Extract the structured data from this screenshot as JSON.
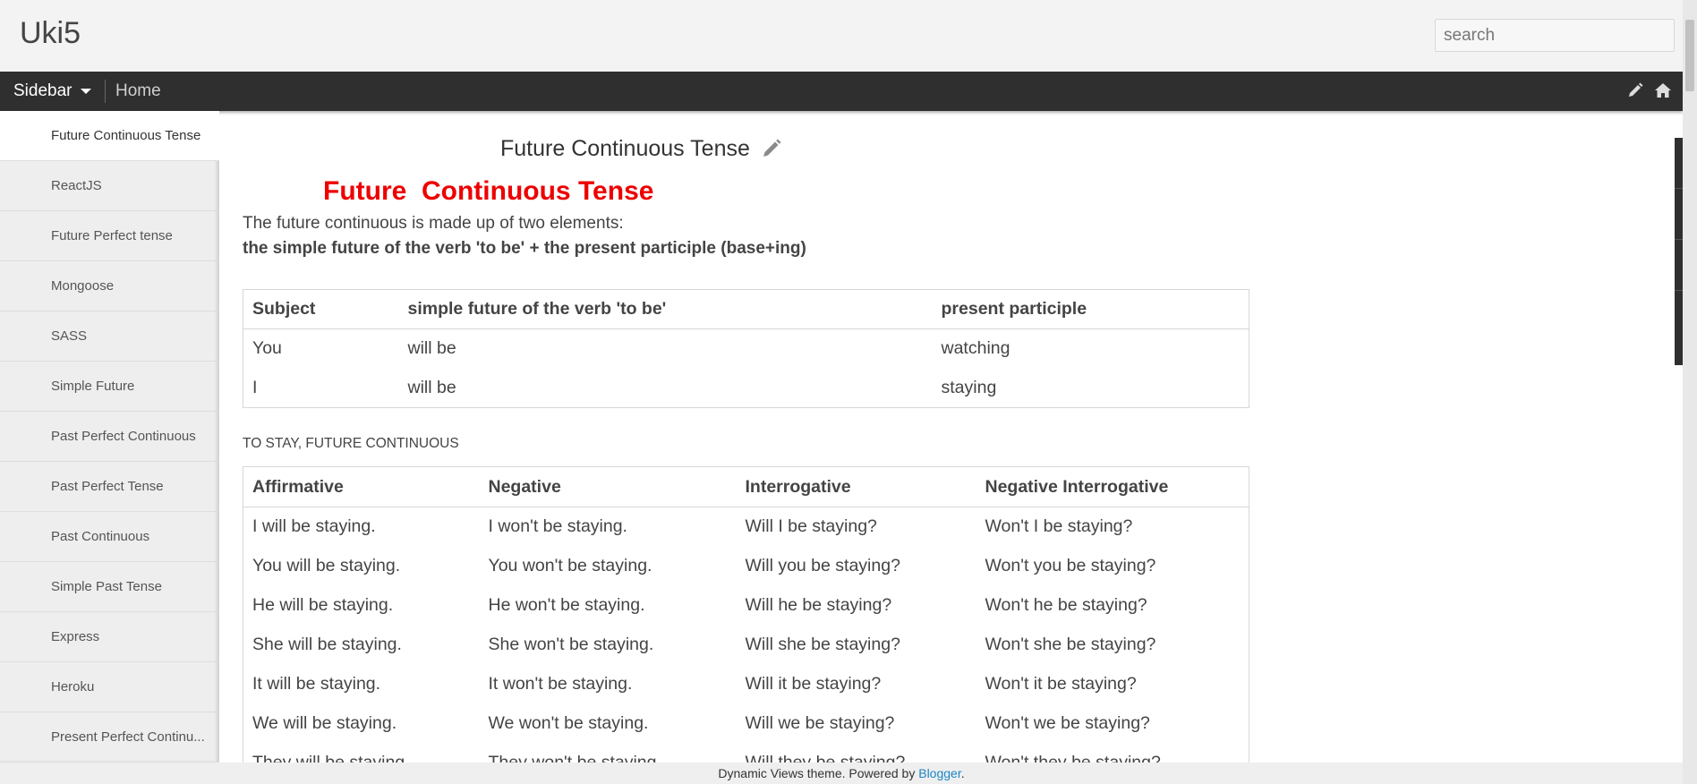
{
  "header": {
    "blog_title": "Uki5",
    "search_placeholder": "search"
  },
  "navbar": {
    "sidebar_label": "Sidebar",
    "home_label": "Home",
    "icons": [
      "pencil-icon",
      "home-icon"
    ]
  },
  "sidebar": {
    "items": [
      {
        "label": "Future Continuous Tense",
        "active": true
      },
      {
        "label": "ReactJS"
      },
      {
        "label": "Future Perfect tense"
      },
      {
        "label": "Mongoose"
      },
      {
        "label": "SASS"
      },
      {
        "label": "Simple Future"
      },
      {
        "label": "Past Perfect Continuous"
      },
      {
        "label": "Past Perfect Tense"
      },
      {
        "label": "Past Continuous"
      },
      {
        "label": "Simple Past Tense"
      },
      {
        "label": "Express"
      },
      {
        "label": "Heroku"
      },
      {
        "label": "Present Perfect Continu..."
      }
    ]
  },
  "post": {
    "title": "Future Continuous Tense",
    "heading": "Future  Continuous Tense",
    "heading_color": "#ee0000",
    "intro": "The future continuous is made up of two elements:",
    "intro_bold": "the simple future of the verb 'to be' + the present participle (base+ing)",
    "table1": {
      "headers": [
        "Subject",
        "simple future of the verb 'to be'",
        "present participle"
      ],
      "rows": [
        [
          "You",
          "will be",
          "watching"
        ],
        [
          "I",
          "will be",
          "staying"
        ]
      ]
    },
    "caption": "TO STAY, FUTURE CONTINUOUS",
    "table2": {
      "headers": [
        "Affirmative",
        "Negative",
        "Interrogative",
        "Negative Interrogative"
      ],
      "rows": [
        [
          "I will be staying.",
          "I won't be staying.",
          "Will I be staying?",
          "Won't I be staying?"
        ],
        [
          "You will be staying.",
          "You won't be staying.",
          "Will you be staying?",
          "Won't you be staying?"
        ],
        [
          "He will be staying.",
          "He won't be staying.",
          "Will he be staying?",
          "Won't he be staying?"
        ],
        [
          "She will be staying.",
          "She won't be staying.",
          "Will she be staying?",
          "Won't she be staying?"
        ],
        [
          "It will be staying.",
          "It won't be staying.",
          "Will it be staying?",
          "Won't it be staying?"
        ],
        [
          "We will be staying.",
          "We won't be staying.",
          "Will we be staying?",
          "Won't we be staying?"
        ],
        [
          "They will be staying.",
          "They won't be staying.",
          "Will they be staying?",
          "Won't they be staying?"
        ]
      ]
    }
  },
  "footer": {
    "text": "Dynamic Views theme. Powered by ",
    "link": "Blogger",
    "suffix": ".",
    "link_color": "#1a86c8"
  }
}
